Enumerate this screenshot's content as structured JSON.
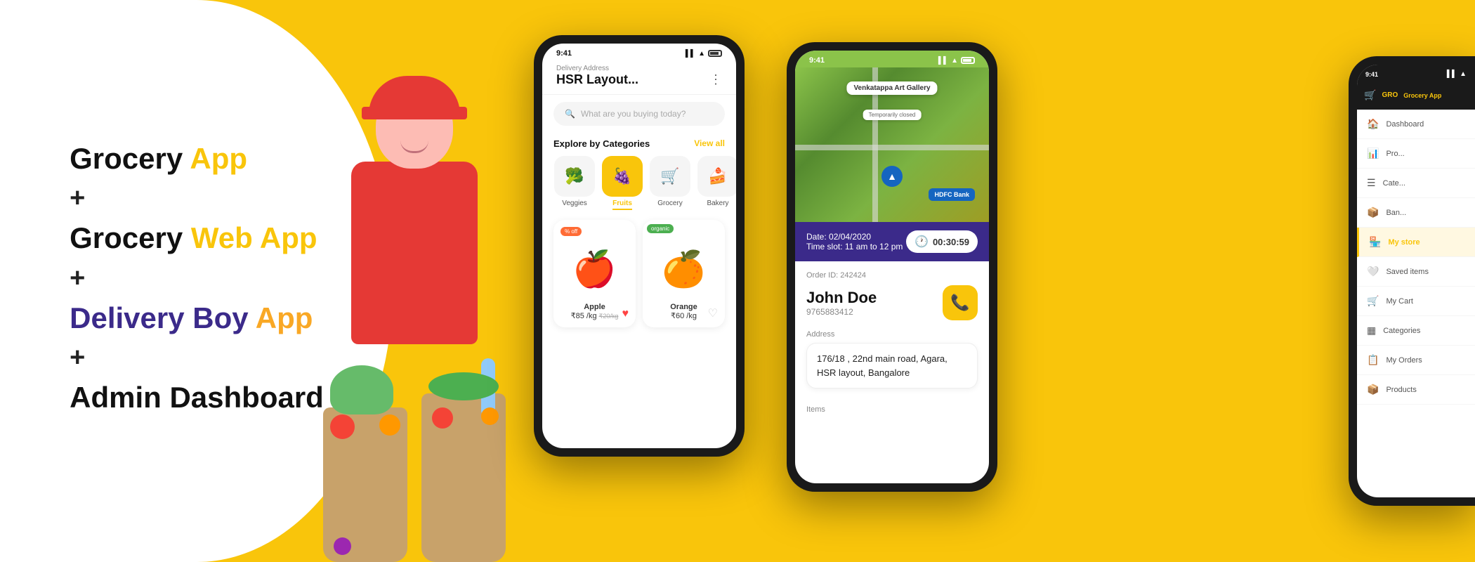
{
  "background": {
    "color": "#F9C50B"
  },
  "left_section": {
    "line1_black": "Grocery",
    "line1_yellow": "App",
    "plus1": "+",
    "line2_black": "Grocery",
    "line2_yellow": "Web App",
    "plus2": "+",
    "line3_purple": "Delivery Boy",
    "line3_yellow": "App",
    "plus3": "+",
    "line4_black": "Admin Dashboard"
  },
  "phone1": {
    "status_time": "9:41",
    "status_icons": "▌▌▌ ▲ ▬",
    "address_label": "Delivery Address",
    "address_value": "HSR Layout...",
    "menu_dots": "⋮",
    "search_placeholder": "What are you buying today?",
    "section_title": "Explore by Categories",
    "view_all": "View all",
    "categories": [
      {
        "icon": "🥦",
        "label": "Veggies",
        "active": false
      },
      {
        "icon": "🍇",
        "label": "Fruits",
        "active": true
      },
      {
        "icon": "🛒",
        "label": "Grocery",
        "active": false
      },
      {
        "icon": "🍰",
        "label": "Bakery",
        "active": false
      }
    ],
    "products": [
      {
        "badge": "% off",
        "emoji": "🍎",
        "name": "Apple",
        "price": "₹85 /kg",
        "original": "₹20/kg",
        "heart": true
      },
      {
        "badge": "organic",
        "emoji": "🍊",
        "name": "Orange",
        "price": "₹60 /kg",
        "original": "",
        "heart": false
      }
    ]
  },
  "phone2": {
    "status_time": "9:41",
    "map_label": "Venkatappa Art Gallery",
    "map_sublabel": "Temporarily closed",
    "map_bank": "HDFC Bank",
    "timer_bar": {
      "date": "Date: 02/04/2020",
      "time_slot": "Time slot: 11 am to 12 pm",
      "timer": "00:30:59"
    },
    "order_id": "Order ID: 242424",
    "customer_name": "John Doe",
    "customer_phone": "9765883412",
    "phone_icon": "📞",
    "address_label": "Address",
    "address_value": "176/18 , 22nd main road, Agara,\nHSR layout, Bangalore",
    "items_label": "Items"
  },
  "phone3": {
    "status_time": "9:41",
    "logo": "GRO",
    "logo_icon": "🛒",
    "nav_items": [
      {
        "icon": "🏠",
        "label": "Dashboard",
        "active": false
      },
      {
        "icon": "📊",
        "label": "Pro...",
        "active": false
      },
      {
        "icon": "☰",
        "label": "Cate...",
        "active": false
      },
      {
        "icon": "📦",
        "label": "Ban...",
        "active": false
      },
      {
        "icon": "🏪",
        "label": "My store",
        "active": true
      },
      {
        "icon": "🤍",
        "label": "Saved items",
        "active": false
      },
      {
        "icon": "🛒",
        "label": "My Cart",
        "active": false
      },
      {
        "icon": "☰",
        "label": "Categories",
        "active": false
      },
      {
        "icon": "📋",
        "label": "My Orders",
        "active": false
      },
      {
        "icon": "📦",
        "label": "Products",
        "active": false
      }
    ]
  }
}
